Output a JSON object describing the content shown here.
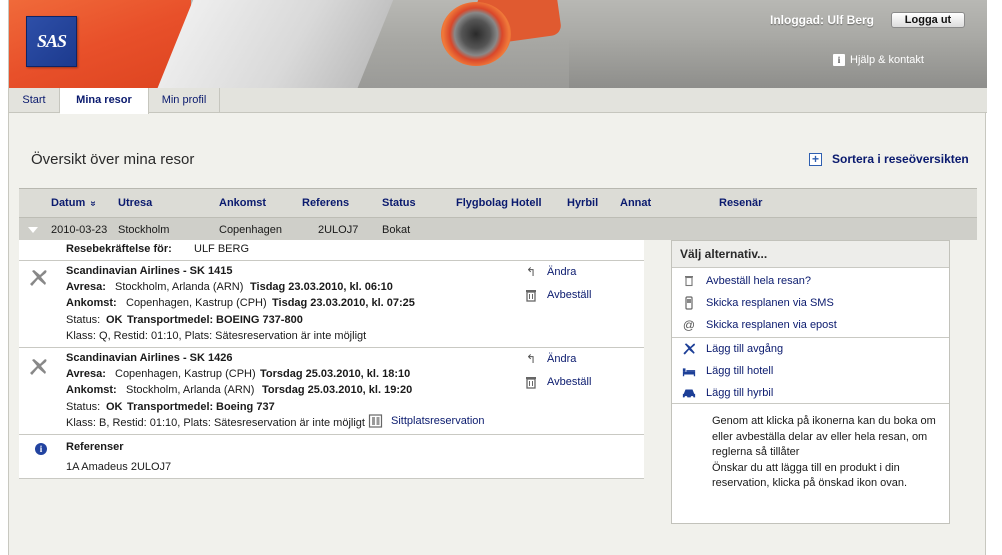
{
  "header": {
    "logo_text": "SAS",
    "logged_in_text": "Inloggad: Ulf Berg",
    "logout_label": "Logga ut",
    "help_label": "Hjälp & kontakt"
  },
  "tabs": [
    {
      "label": "Start",
      "active": false
    },
    {
      "label": "Mina resor",
      "active": true
    },
    {
      "label": "Min profil",
      "active": false
    }
  ],
  "page": {
    "title": "Översikt över mina resor",
    "sort_label": "Sortera i reseöversikten"
  },
  "table": {
    "headers": {
      "datum": "Datum",
      "sort_icon": "»",
      "utresa": "Utresa",
      "ankomst": "Ankomst",
      "referens": "Referens",
      "status": "Status",
      "flygbolag": "Flygbolag",
      "hotell": "Hotell",
      "hyrbil": "Hyrbil",
      "annat": "Annat",
      "resenar": "Resenär"
    },
    "row": {
      "datum": "2010-03-23",
      "utresa": "Stockholm",
      "ankomst": "Copenhagen",
      "referens": "2ULOJ7",
      "status": "Bokat"
    }
  },
  "details": {
    "confirmation_label": "Resebekräftelse för:",
    "confirmation_name": "ULF BERG",
    "flights": [
      {
        "title": "Scandinavian Airlines - SK 1415",
        "avresa_label": "Avresa:",
        "avresa_place": "Stockholm, Arlanda (ARN)",
        "avresa_time": "Tisdag 23.03.2010, kl. 06:10",
        "ankomst_label": "Ankomst:",
        "ankomst_place": "Copenhagen, Kastrup (CPH)",
        "ankomst_time": "Tisdag 23.03.2010, kl. 07:25",
        "status_label": "Status:",
        "status_value": "OK",
        "transport_label": "Transportmedel:",
        "transport_value": "BOEING 737-800",
        "klass_line": "Klass: Q, Restid: 01:10, Plats: Sätesreservation är inte möjligt",
        "edit_label": "Ändra",
        "cancel_label": "Avbeställ"
      },
      {
        "title": "Scandinavian Airlines - SK 1426",
        "avresa_label": "Avresa:",
        "avresa_place": "Copenhagen, Kastrup (CPH)",
        "avresa_time": "Torsdag 25.03.2010, kl. 18:10",
        "ankomst_label": "Ankomst:",
        "ankomst_place": "Stockholm, Arlanda (ARN)",
        "ankomst_time": "Torsdag 25.03.2010, kl. 19:20",
        "status_label": "Status:",
        "status_value": "OK",
        "transport_label": "Transportmedel:",
        "transport_value": "Boeing 737",
        "klass_line": "Klass: B, Restid: 01:10, Plats: Sätesreservation är inte möjligt",
        "seat_label": "Sittplatsreservation",
        "edit_label": "Ändra",
        "cancel_label": "Avbeställ"
      }
    ],
    "references_title": "Referenser",
    "references_value": "1A Amadeus 2ULOJ7"
  },
  "options": {
    "title": "Välj alternativ...",
    "items": [
      {
        "label": "Avbeställ hela resan?",
        "icon": "trash-icon"
      },
      {
        "label": "Skicka resplanen via SMS",
        "icon": "phone-icon"
      },
      {
        "label": "Skicka resplanen via epost",
        "icon": "at-icon"
      },
      {
        "label": "Lägg till avgång",
        "icon": "plane-icon"
      },
      {
        "label": "Lägg till hotell",
        "icon": "bed-icon"
      },
      {
        "label": "Lägg till hyrbil",
        "icon": "car-icon"
      }
    ],
    "help_text": "Genom att klicka på ikonerna kan du boka om eller avbeställa delar av eller hela resan, om reglerna så tillåter\nÖnskar du att lägga till en produkt i din reservation, klicka på önskad ikon ovan."
  }
}
